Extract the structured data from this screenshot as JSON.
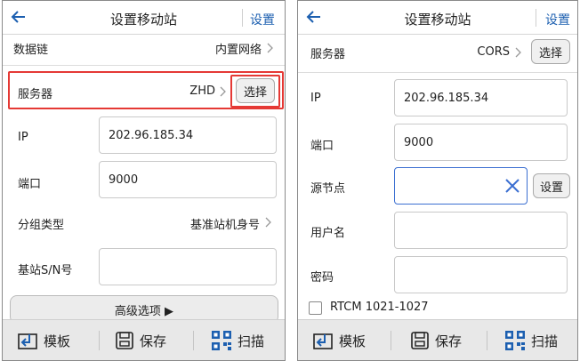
{
  "left": {
    "header": {
      "title": "设置移动站",
      "action": "设置"
    },
    "rows": {
      "datalink": {
        "label": "数据链",
        "value": "内置网络"
      },
      "server": {
        "label": "服务器",
        "value": "ZHD",
        "button": "选择"
      },
      "ip": {
        "label": "IP",
        "value": "202.96.185.34"
      },
      "port": {
        "label": "端口",
        "value": "9000"
      },
      "group": {
        "label": "分组类型",
        "value": "基准站机身号"
      },
      "sn": {
        "label": "基站S/N号",
        "value": ""
      }
    },
    "advanced": "高级选项 ▶",
    "bottom": {
      "template": "模板",
      "save": "保存",
      "scan": "扫描"
    }
  },
  "right": {
    "header": {
      "title": "设置移动站",
      "action": "设置"
    },
    "rows": {
      "server": {
        "label": "服务器",
        "value": "CORS",
        "button": "选择"
      },
      "ip": {
        "label": "IP",
        "value": "202.96.185.34"
      },
      "port": {
        "label": "端口",
        "value": "9000"
      },
      "mount": {
        "label": "源节点",
        "value": "",
        "button": "设置"
      },
      "user": {
        "label": "用户名",
        "value": ""
      },
      "pwd": {
        "label": "密码",
        "value": ""
      },
      "rtcm": {
        "label": "RTCM 1021-1027",
        "checked": false
      }
    },
    "bottom": {
      "template": "模板",
      "save": "保存",
      "scan": "扫描"
    }
  },
  "colors": {
    "accent": "#1c5fb0",
    "highlight": "#e53935",
    "focus": "#3b6fd1"
  }
}
